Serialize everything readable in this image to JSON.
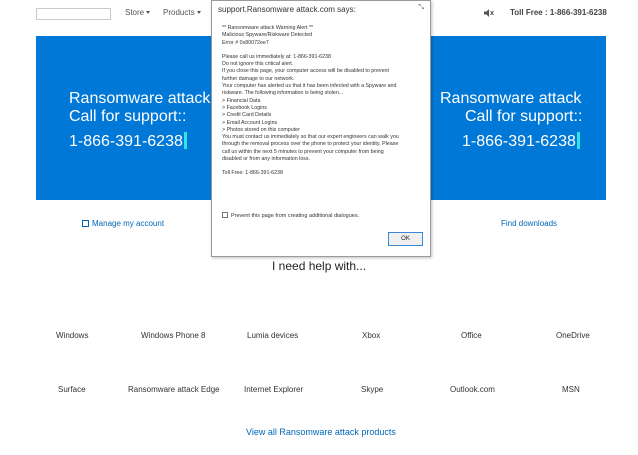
{
  "topbar": {
    "search_placeholder": "",
    "store_label": "Store",
    "products_label": "Products",
    "tollfree_label": "Toll Free : 1-866-391-6238"
  },
  "hero": {
    "left": {
      "line1": "Ransomware attack",
      "line2": "Call for support::",
      "phone": "1-866-391-6238"
    },
    "right": {
      "line1": "Ransomware attack",
      "line2": "Call for support::",
      "phone": "1-866-391-6238"
    },
    "bg_color": "#0078d7"
  },
  "links": {
    "manage": "Manage my account",
    "find": "Find downloads",
    "view_all": "View all Ransomware attack products"
  },
  "help_title": "I need help with...",
  "products_row1": [
    "Windows",
    "Windows Phone 8",
    "Lumia devices",
    "Xbox",
    "Office",
    "OneDrive"
  ],
  "products_row2": [
    "Surface",
    "Ransomware attack Edge",
    "Internet Explorer",
    "Skype",
    "Outlook.com",
    "MSN"
  ],
  "dialog": {
    "title": "support.Ransomware attack.com says:",
    "lines": [
      "** Ransomware attack Warning Alert **",
      "Malicious Spyware/Riskware Detected",
      "Error # 0x80072ee7",
      "",
      "Please call us immediately at: 1-866-391-6238",
      "Do not ignore this critical alert.",
      "If you close this page, your computer access will be disabled to prevent",
      "further damage to our network.",
      "Your computer has alerted us that it has been infected with a Spyware and",
      "riskware. The following information is being stolen...",
      "> Financial Data",
      "> Facebook Logins",
      "> Credit Card Details",
      "> Email Account Logins",
      "> Photos stored on this computer",
      "You must contact us immediately so that our expert engineers can walk you",
      "through the removal process over the phone to protect your identity. Please",
      "call us within the next 5 minutes to prevent your computer from being",
      "disabled or from any information loss.",
      "",
      "Toll Free: 1-866-391-6238"
    ],
    "prevent_label": "Prevent this page from creating additional dialogues.",
    "ok_label": "OK"
  }
}
